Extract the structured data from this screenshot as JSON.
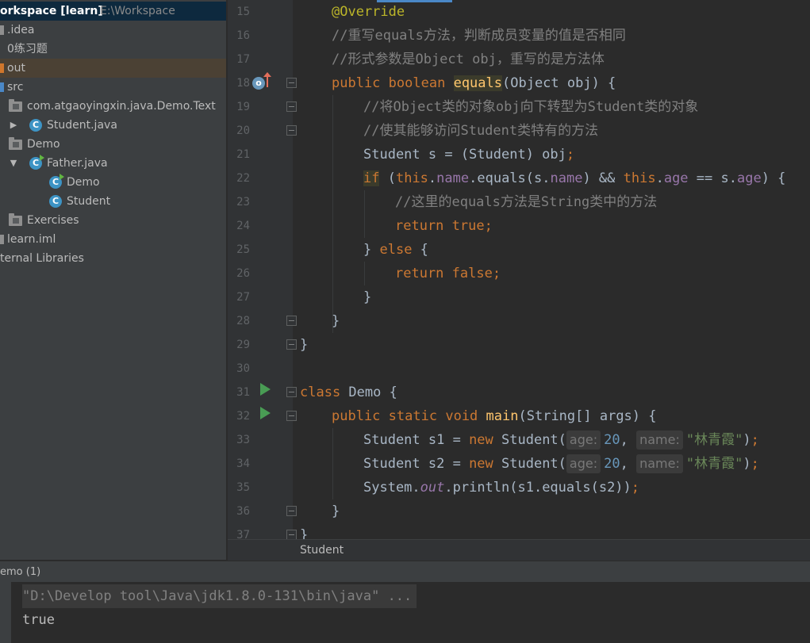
{
  "project_tree": {
    "root_label": "orkspace [learn]",
    "root_path": "E:\\Workspace",
    "items": [
      {
        "label": ".idea"
      },
      {
        "label": "0练习题"
      },
      {
        "label": "out"
      },
      {
        "label": "src"
      },
      {
        "label": "com.atgaoyingxin.java.Demo.Text"
      },
      {
        "label": "Student.java"
      },
      {
        "label": "Demo"
      },
      {
        "label": "Father.java"
      },
      {
        "label": "Demo"
      },
      {
        "label": "Student"
      },
      {
        "label": "Exercises"
      },
      {
        "label": "learn.iml"
      },
      {
        "label": "ternal Libraries"
      }
    ]
  },
  "editor": {
    "line_numbers": [
      "15",
      "16",
      "17",
      "18",
      "19",
      "20",
      "21",
      "22",
      "23",
      "24",
      "25",
      "26",
      "27",
      "28",
      "29",
      "30",
      "31",
      "32",
      "33",
      "34",
      "35",
      "36",
      "37"
    ],
    "lines": {
      "l15": "@Override",
      "l16": "//重写equals方法，判断成员变量的值是否相同",
      "l17": "//形式参数是Object obj，重写的是方法体",
      "l18": {
        "kw1": "public",
        "kw2": "boolean",
        "method": "equals",
        "rest": "(Object obj) {"
      },
      "l19": "//将Object类的对象obj向下转型为Student类的对象",
      "l20": "//使其能够访问Student类特有的方法",
      "l21": {
        "a": "Student s = (Student) obj",
        "semi": ";"
      },
      "l22": {
        "kw_if": "if",
        "p1": " (",
        "this1": "this",
        "dot1": ".",
        "name1": "name",
        "p2": ".equals(s.",
        "name2": "name",
        "p3": ") && ",
        "this2": "this",
        "dot2": ".",
        "age1": "age",
        "p4": " == s.",
        "age2": "age",
        "p5": ") {"
      },
      "l23": "//这里的equals方法是String类中的方法",
      "l24": {
        "kw_return": "return",
        "sp": " ",
        "kw_true": "true",
        "semi": ";"
      },
      "l25": {
        "a": "} ",
        "kw_else": "else",
        "b": " {"
      },
      "l26": {
        "kw_return": "return",
        "sp": " ",
        "kw_false": "false",
        "semi": ";"
      },
      "l27": "}",
      "l28": "}",
      "l29": "}",
      "l30": "",
      "l31": {
        "kw_class": "class",
        "rest": " Demo {"
      },
      "l32": {
        "kw1": "public",
        "kw2": "static",
        "kw3": "void",
        "method": "main",
        "rest": "(String[] args) {"
      },
      "l33": {
        "a": "Student s1 = ",
        "kw_new": "new",
        "b": " Student(",
        "hint_age": "age:",
        "num": "20",
        "c": ", ",
        "hint_name": "name:",
        "str": "\"林青霞\"",
        "d": ")",
        "semi": ";"
      },
      "l34": {
        "a": "Student s2 = ",
        "kw_new": "new",
        "b": " Student(",
        "hint_age": "age:",
        "num": "20",
        "c": ", ",
        "hint_name": "name:",
        "str": "\"林青霞\"",
        "d": ")",
        "semi": ";"
      },
      "l35": {
        "a": "System.",
        "out": "out",
        "b": ".println(s1.equals(s2))",
        "semi": ";"
      },
      "l36": "}",
      "l37": "}"
    },
    "gutter_icons": {
      "override": "o",
      "override_icon": "overrides-method-icon",
      "run_icon": "run-gutter-icon"
    }
  },
  "breadcrumb": {
    "label": "Student"
  },
  "run_panel": {
    "title": "emo (1)",
    "command": "\"D:\\Develop tool\\Java\\jdk1.8.0-131\\bin\\java\" ...",
    "output": "true"
  },
  "colors": {
    "keyword": "#cc7832",
    "comment": "#808080",
    "string": "#6a8759",
    "number": "#6897bb",
    "field": "#9876aa",
    "method": "#ffc66d",
    "annotation": "#bbb529"
  }
}
